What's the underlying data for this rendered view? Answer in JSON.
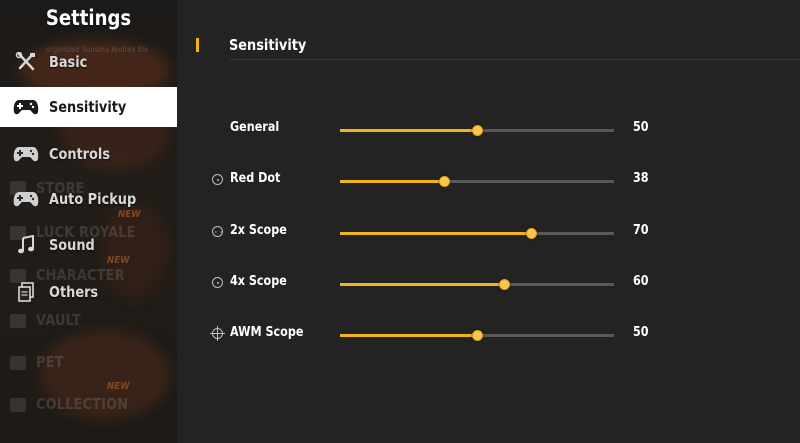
{
  "sidebar": {
    "title": "Settings",
    "items": [
      {
        "label": "Basic",
        "icon": "tools-icon",
        "active": false
      },
      {
        "label": "Sensitivity",
        "icon": "gamepad-icon",
        "active": true
      },
      {
        "label": "Controls",
        "icon": "gamepad-icon",
        "active": false
      },
      {
        "label": "Auto Pickup",
        "icon": "gamepad-icon",
        "active": false
      },
      {
        "label": "Sound",
        "icon": "music-note-icon",
        "active": false
      },
      {
        "label": "Others",
        "icon": "documents-icon",
        "active": false
      }
    ],
    "background_menu": [
      {
        "label": "STORE"
      },
      {
        "label": "LUCK ROYALE"
      },
      {
        "label": "CHARACTER"
      },
      {
        "label": "VAULT"
      },
      {
        "label": "PET"
      },
      {
        "label": "COLLECTION"
      }
    ],
    "background_new_badge": "NEW"
  },
  "main": {
    "header": {
      "title": "Sensitivity"
    },
    "settings": [
      {
        "label": "General",
        "icon": "",
        "value": 50,
        "max": 100
      },
      {
        "label": "Red Dot",
        "icon": "red-dot-sight-icon",
        "value": 38,
        "max": 100
      },
      {
        "label": "2x Scope",
        "icon": "scope-2x-icon",
        "value": 70,
        "max": 100
      },
      {
        "label": "4x Scope",
        "icon": "scope-4x-icon",
        "value": 60,
        "max": 100
      },
      {
        "label": "AWM Scope",
        "icon": "crosshair-icon",
        "value": 50,
        "max": 100
      }
    ]
  },
  "colors": {
    "accent": "#f3b31b",
    "track": "#5a5a5a",
    "panel_bg": "#232323",
    "active_item_bg": "#ffffff"
  }
}
